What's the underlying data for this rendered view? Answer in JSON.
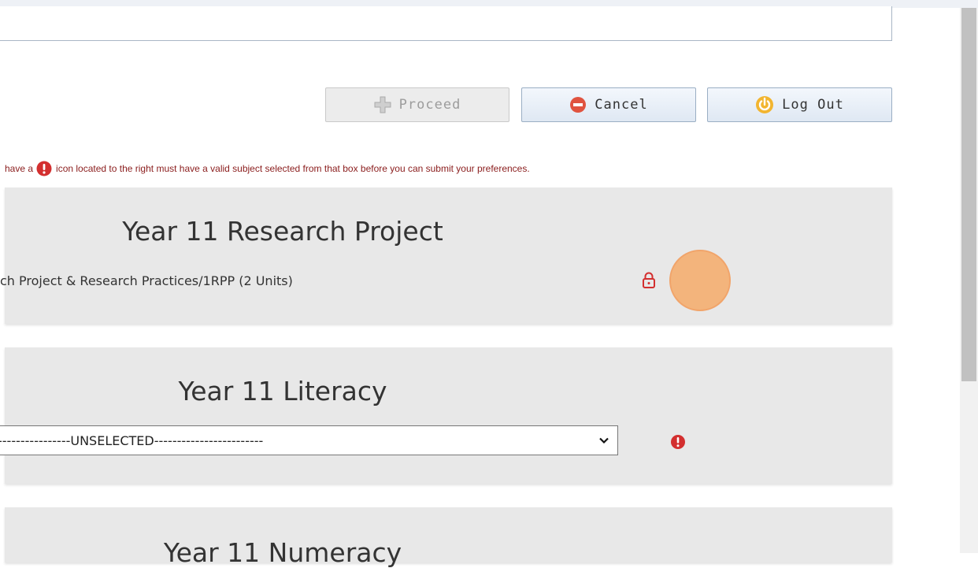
{
  "toolbar": {
    "proceed_label": "Proceed",
    "cancel_label": "Cancel",
    "logout_label": "Log Out"
  },
  "notice": {
    "prefix": "have a",
    "suffix": "icon located to the right must have a valid subject selected from that box before you can submit your preferences."
  },
  "sections": [
    {
      "title": "Year 11 Research Project",
      "subject": "ch Project & Research Practices/1RPP (2 Units)",
      "status_icon": "lock-icon"
    },
    {
      "title": "Year 11 Literacy",
      "selected": "----------------UNSELECTED------------------------",
      "status_icon": "warning-icon"
    },
    {
      "title": "Year 11 Numeracy"
    }
  ],
  "colors": {
    "warning_red": "#d32f2f",
    "notice_text": "#8a1c1c",
    "panel_bg": "#e8e8e8",
    "cursor_highlight": "#f5aa69"
  }
}
